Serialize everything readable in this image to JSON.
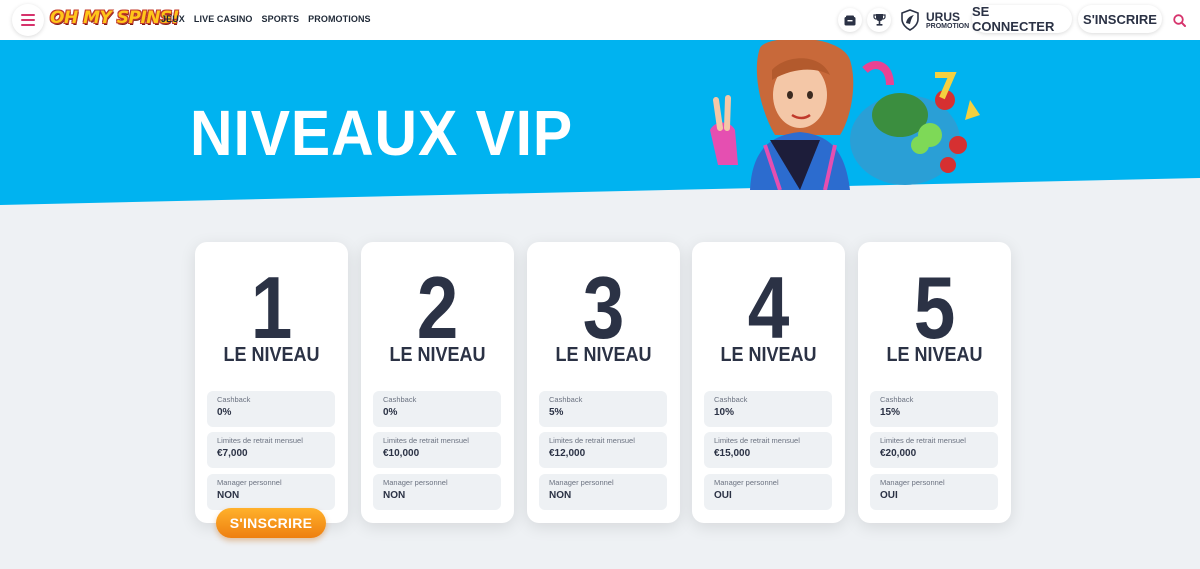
{
  "header": {
    "logo_text": "OH MY SPINS!",
    "nav": [
      "JEUX",
      "LIVE CASINO",
      "SPORTS",
      "PROMOTIONS"
    ],
    "urus": {
      "name": "URUS",
      "sub": "PROMOTION"
    },
    "login_label": "SE CONNECTER",
    "signup_label": "S'INSCRIRE",
    "icons": [
      "menu-icon",
      "cashier-icon",
      "trophy-icon",
      "shield-icon",
      "search-icon"
    ]
  },
  "hero": {
    "title": "NIVEAUX VIP",
    "band_color": "#00b3f0"
  },
  "levels": [
    {
      "number": "1",
      "label": "LE NIVEAU",
      "stats": [
        {
          "label": "Cashback",
          "value": "0%"
        },
        {
          "label": "Limites de retrait mensuel",
          "value": "€7,000"
        },
        {
          "label": "Manager personnel",
          "value": "NON"
        }
      ]
    },
    {
      "number": "2",
      "label": "LE NIVEAU",
      "stats": [
        {
          "label": "Cashback",
          "value": "0%"
        },
        {
          "label": "Limites de retrait mensuel",
          "value": "€10,000"
        },
        {
          "label": "Manager personnel",
          "value": "NON"
        }
      ]
    },
    {
      "number": "3",
      "label": "LE NIVEAU",
      "stats": [
        {
          "label": "Cashback",
          "value": "5%"
        },
        {
          "label": "Limites de retrait mensuel",
          "value": "€12,000"
        },
        {
          "label": "Manager personnel",
          "value": "NON"
        }
      ]
    },
    {
      "number": "4",
      "label": "LE NIVEAU",
      "stats": [
        {
          "label": "Cashback",
          "value": "10%"
        },
        {
          "label": "Limites de retrait mensuel",
          "value": "€15,000"
        },
        {
          "label": "Manager personnel",
          "value": "OUI"
        }
      ]
    },
    {
      "number": "5",
      "label": "LE NIVEAU",
      "stats": [
        {
          "label": "Cashback",
          "value": "15%"
        },
        {
          "label": "Limites de retrait mensuel",
          "value": "€20,000"
        },
        {
          "label": "Manager personnel",
          "value": "OUI"
        }
      ]
    }
  ],
  "cta": {
    "label": "S'INSCRIRE",
    "color": "#f39a1c"
  }
}
